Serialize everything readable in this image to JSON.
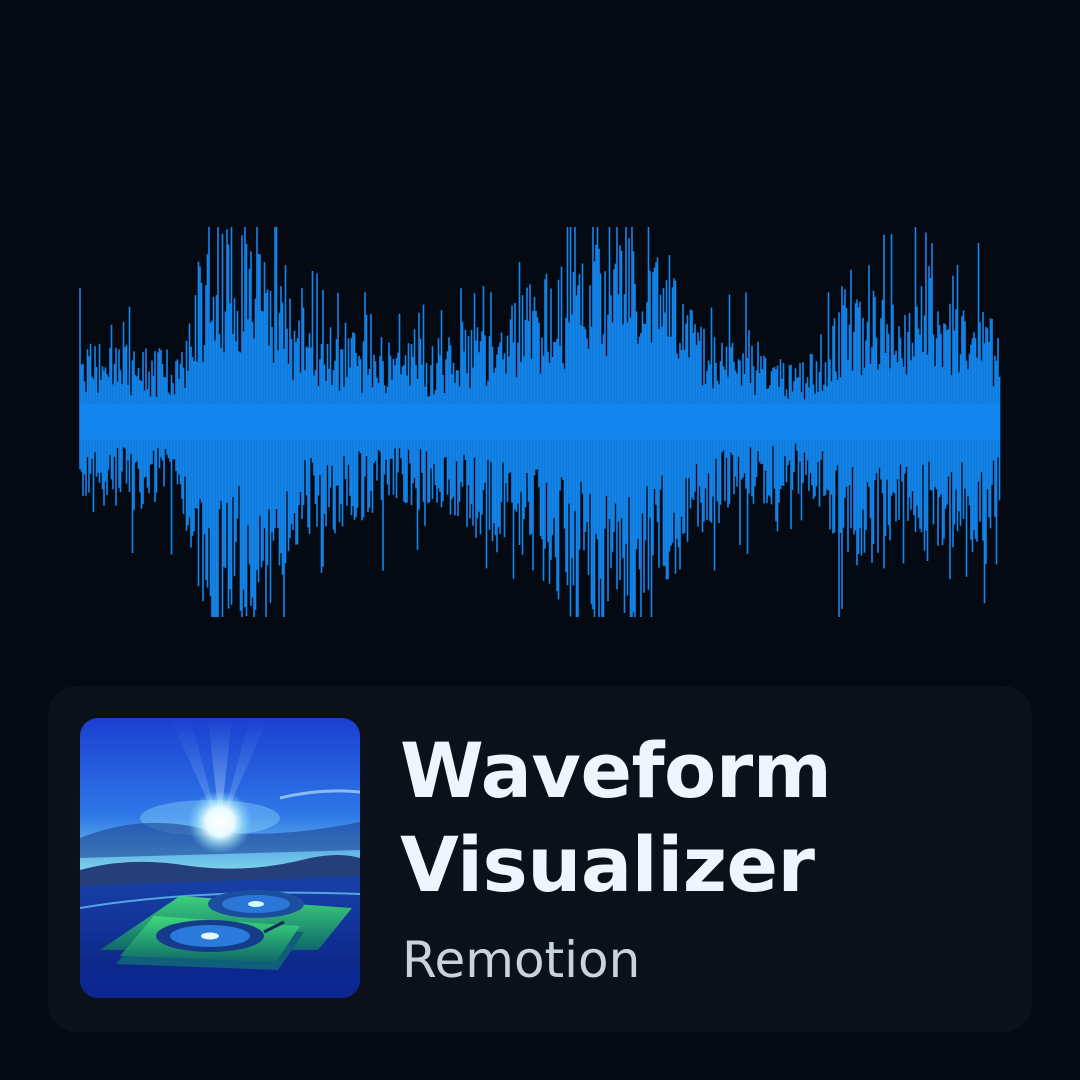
{
  "colors": {
    "background": "#050a12",
    "waveform": "#1386ee",
    "card": "#0a111a",
    "title": "#eef5ff",
    "subtitle": "#c9d3df"
  },
  "waveform": {
    "seed": 7,
    "envelope": [
      {
        "pos": 0.0,
        "amp": 0.2
      },
      {
        "pos": 0.11,
        "amp": 0.17
      },
      {
        "pos": 0.14,
        "amp": 0.5
      },
      {
        "pos": 0.2,
        "amp": 0.45
      },
      {
        "pos": 0.24,
        "amp": 0.24
      },
      {
        "pos": 0.38,
        "amp": 0.18
      },
      {
        "pos": 0.45,
        "amp": 0.26
      },
      {
        "pos": 0.6,
        "amp": 0.52
      },
      {
        "pos": 0.68,
        "amp": 0.22
      },
      {
        "pos": 0.79,
        "amp": 0.15
      },
      {
        "pos": 0.84,
        "amp": 0.32
      },
      {
        "pos": 1.0,
        "amp": 0.26
      }
    ]
  },
  "track": {
    "title_line1": "Waveform",
    "title_line2": "Visualizer",
    "artist": "Remotion"
  },
  "cover_art": {
    "icon": "turntables-sunrise-artwork"
  }
}
